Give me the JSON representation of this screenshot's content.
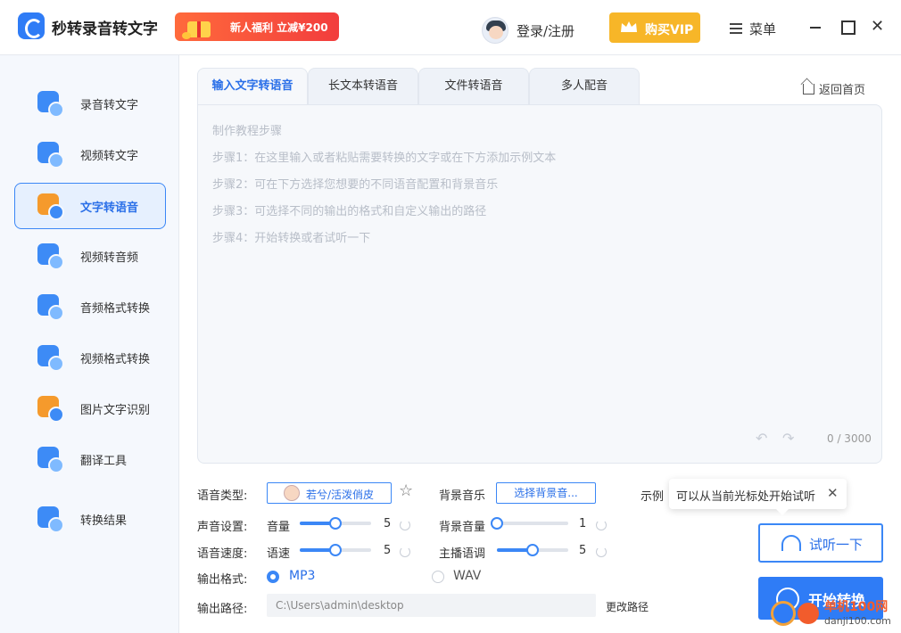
{
  "app": {
    "title": "秒转录音转文字"
  },
  "header": {
    "promo_text": "新人福利 立减¥200",
    "login_label": "登录/注册",
    "vip_label": "购买VIP",
    "menu_label": "菜单",
    "close_glyph": "✕"
  },
  "sidebar": {
    "items": [
      {
        "label": "录音转文字",
        "active": false
      },
      {
        "label": "视频转文字",
        "active": false
      },
      {
        "label": "文字转语音",
        "active": true
      },
      {
        "label": "视频转音频",
        "active": false
      },
      {
        "label": "音频格式转换",
        "active": false
      },
      {
        "label": "视频格式转换",
        "active": false
      },
      {
        "label": "图片文字识别",
        "active": false
      },
      {
        "label": "翻译工具",
        "active": false
      },
      {
        "label": "转换结果",
        "active": false
      }
    ]
  },
  "tabs": [
    {
      "label": "输入文字转语音",
      "active": true
    },
    {
      "label": "长文本转语音",
      "active": false
    },
    {
      "label": "文件转语音",
      "active": false
    },
    {
      "label": "多人配音",
      "active": false
    }
  ],
  "back_home": "返回首页",
  "editor": {
    "tutorial": [
      "制作教程步骤",
      "步骤1：在这里输入或者粘贴需要转换的文字或在下方添加示例文本",
      "步骤2：可在下方选择您想要的不同语音配置和背景音乐",
      "步骤3：可选择不同的输出的格式和自定义输出的路径",
      "步骤4：开始转换或者试听一下"
    ],
    "undo_glyph": "↶",
    "redo_glyph": "↷",
    "char_count": "0 / 3000"
  },
  "settings": {
    "voice_type_label": "语音类型:",
    "voice_value": "若兮/活泼俏皮",
    "star_glyph": "☆",
    "bg_music_label": "背景音乐",
    "bg_music_button": "选择背景音...",
    "sound_label": "声音设置:",
    "volume_label": "音量",
    "volume_value": "5",
    "volume_fraction": 0.5,
    "bg_volume_label": "背景音量",
    "bg_volume_value": "1",
    "bg_volume_fraction": 0.0,
    "speed_section_label": "语音速度:",
    "speed_label": "语速",
    "speed_value": "5",
    "speed_fraction": 0.5,
    "pitch_label": "主播语调",
    "pitch_value": "5",
    "pitch_fraction": 0.5,
    "format_label": "输出格式:",
    "formats": [
      {
        "label": "MP3",
        "selected": true
      },
      {
        "label": "WAV",
        "selected": false
      }
    ],
    "path_label": "输出路径:",
    "path_value": "C:\\Users\\admin\\desktop",
    "change_path": "更改路径"
  },
  "right": {
    "example_label": "示例",
    "tooltip_text": "可以从当前光标处开始试听",
    "tooltip_close": "✕",
    "listen_label": "试听一下",
    "start_label": "开始转换"
  },
  "watermark": {
    "line1": "单机100网",
    "line2": "danji100.com"
  },
  "colors": {
    "accent": "#2f7cf6",
    "vip": "#f7b628",
    "promo": "#f23d3d",
    "sidebar_bg": "#f5f8fd"
  }
}
